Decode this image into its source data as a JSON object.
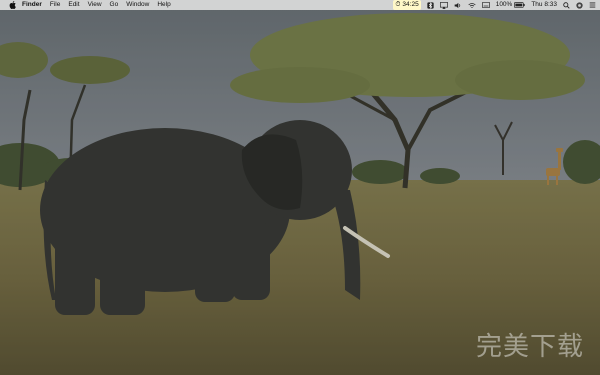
{
  "menubar": {
    "app_name": "Finder",
    "menus": [
      "File",
      "Edit",
      "View",
      "Go",
      "Window",
      "Help"
    ],
    "status": {
      "timer": "34:25",
      "battery": "100%",
      "clock": "Thu 8:33"
    }
  },
  "watermark": {
    "text": "完美下载"
  },
  "icons": [
    "apple-icon",
    "timer-icon",
    "bluetooth-icon",
    "airplay-icon",
    "volume-icon",
    "wifi-icon",
    "keyboard-icon",
    "battery-icon",
    "search-icon",
    "siri-icon",
    "menu-icon"
  ]
}
